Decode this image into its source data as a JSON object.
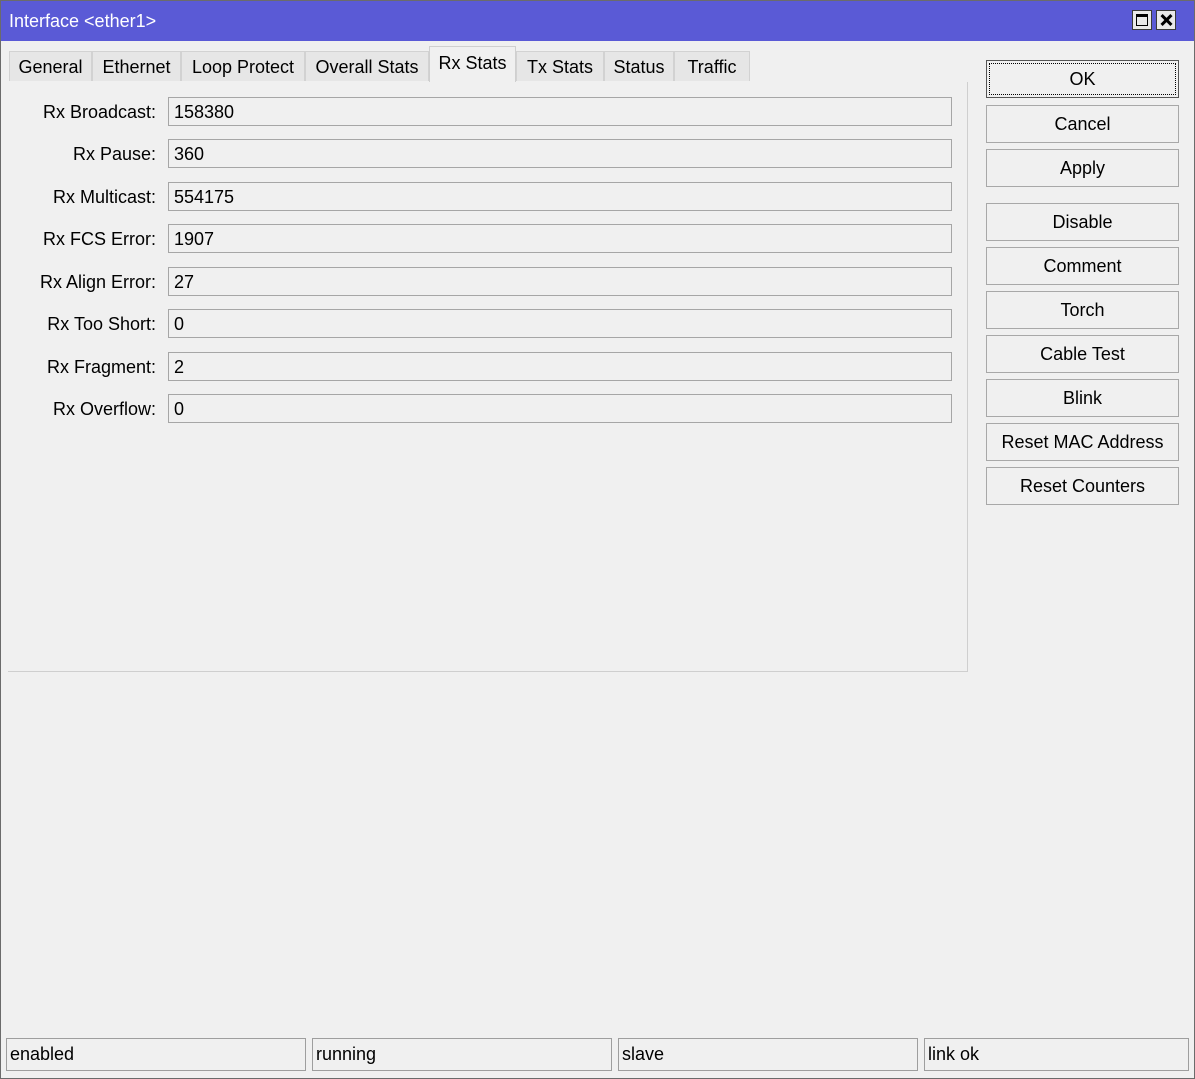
{
  "window": {
    "title": "Interface <ether1>"
  },
  "tabs": [
    {
      "label": "General"
    },
    {
      "label": "Ethernet"
    },
    {
      "label": "Loop Protect"
    },
    {
      "label": "Overall Stats"
    },
    {
      "label": "Rx Stats",
      "active": true
    },
    {
      "label": "Tx Stats"
    },
    {
      "label": "Status"
    },
    {
      "label": "Traffic"
    }
  ],
  "fields": [
    {
      "label": "Rx Broadcast:",
      "value": "158380"
    },
    {
      "label": "Rx Pause:",
      "value": "360"
    },
    {
      "label": "Rx Multicast:",
      "value": "554175"
    },
    {
      "label": "Rx FCS Error:",
      "value": "1907"
    },
    {
      "label": "Rx Align Error:",
      "value": "27"
    },
    {
      "label": "Rx Too Short:",
      "value": "0"
    },
    {
      "label": "Rx Fragment:",
      "value": "2"
    },
    {
      "label": "Rx Overflow:",
      "value": "0"
    }
  ],
  "buttons": {
    "ok": "OK",
    "cancel": "Cancel",
    "apply": "Apply",
    "disable": "Disable",
    "comment": "Comment",
    "torch": "Torch",
    "cable_test": "Cable Test",
    "blink": "Blink",
    "reset_mac": "Reset MAC Address",
    "reset_counters": "Reset Counters"
  },
  "status": [
    "enabled",
    "running",
    "slave",
    "link ok"
  ],
  "colors": {
    "titlebar": "#5a5ad6",
    "background": "#f0f0f0"
  }
}
